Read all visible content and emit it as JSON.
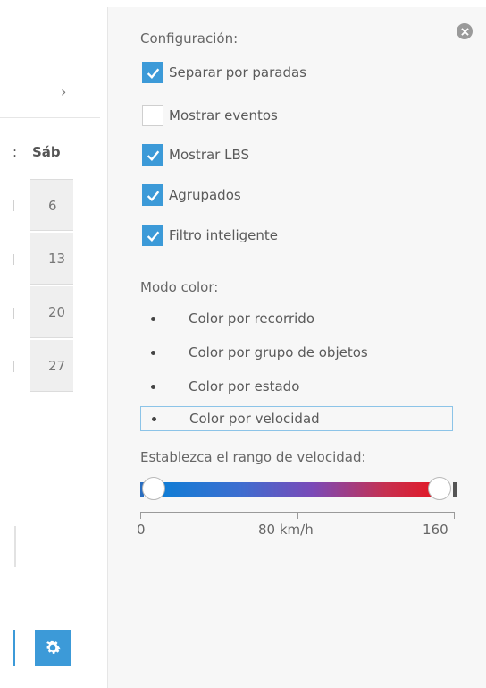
{
  "calendar": {
    "nav_arrow": "›",
    "day_header": "Sáb",
    "day_header_fragment": ":",
    "dates": [
      "6",
      "13",
      "20",
      "27"
    ]
  },
  "settings": {
    "config_title": "Configuración:",
    "checkboxes": [
      {
        "label": "Separar por paradas",
        "checked": true
      },
      {
        "label": "Mostrar eventos",
        "checked": false
      },
      {
        "label": "Mostrar LBS",
        "checked": true
      },
      {
        "label": "Agrupados",
        "checked": true
      },
      {
        "label": "Filtro inteligente",
        "checked": true
      }
    ],
    "color_mode_title": "Modo color:",
    "color_modes": [
      {
        "label": "Color por recorrido",
        "selected": false
      },
      {
        "label": "Color por grupo de objetos",
        "selected": false
      },
      {
        "label": "Color por estado",
        "selected": false
      },
      {
        "label": "Color por velocidad",
        "selected": true
      }
    ],
    "speed_range_title": "Establezca el rango de velocidad:",
    "speed_range": {
      "min": 0,
      "max": 160,
      "selected_min": 0,
      "selected_max": 160
    },
    "axis_labels": [
      "0",
      "80 km/h",
      "160"
    ]
  },
  "colors": {
    "accent": "#3c9ad8",
    "gradient_start": "#0a7fd6",
    "gradient_end": "#e8141e",
    "panel_bg": "#f7f7f7"
  },
  "icons": {
    "close": "close-circle-icon",
    "settings": "gear-icon",
    "check": "checkmark-icon"
  }
}
